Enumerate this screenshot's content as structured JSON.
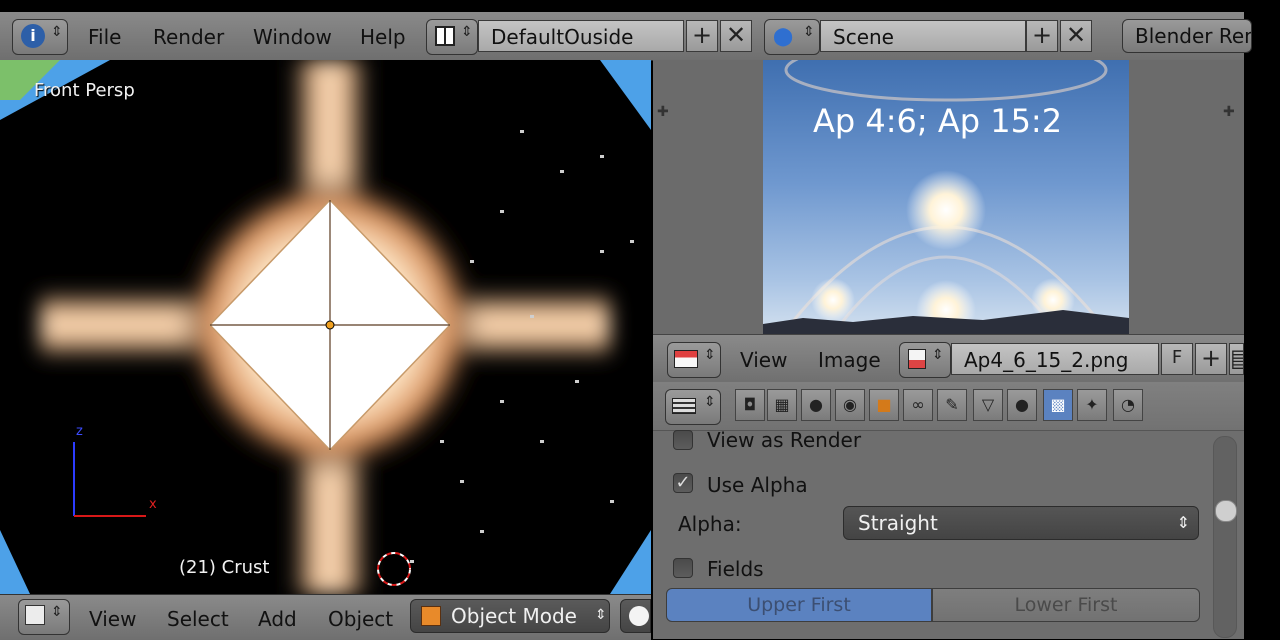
{
  "top_header": {
    "info_icon": "info-icon",
    "menus": [
      "File",
      "Render",
      "Window",
      "Help"
    ],
    "screen_layout": "DefaultOuside",
    "scene": "Scene",
    "engine": "Blender Ren"
  },
  "viewport": {
    "view_label": "Front Persp",
    "object_label": "(21) Crust",
    "axis_z": "z",
    "axis_x": "x"
  },
  "bottom_header": {
    "menus": [
      "View",
      "Select",
      "Add",
      "Object"
    ],
    "mode": "Object Mode"
  },
  "image_editor": {
    "preview_caption": "Ap 4:6; Ap 15:2",
    "menus": [
      "View",
      "Image"
    ],
    "image_name": "Ap4_6_15_2.png",
    "fake_user": "F"
  },
  "properties": {
    "view_as_render": {
      "label": "View as Render",
      "checked": false
    },
    "use_alpha": {
      "label": "Use Alpha",
      "checked": true
    },
    "alpha_label": "Alpha:",
    "alpha_value": "Straight",
    "fields": {
      "label": "Fields",
      "checked": false
    },
    "field_order": {
      "upper": "Upper First",
      "lower": "Lower First",
      "selected": "upper"
    }
  },
  "colors": {
    "header": "#7a7a7a",
    "selected_blue": "#5b82c0",
    "viewport_bg": "#000000"
  }
}
